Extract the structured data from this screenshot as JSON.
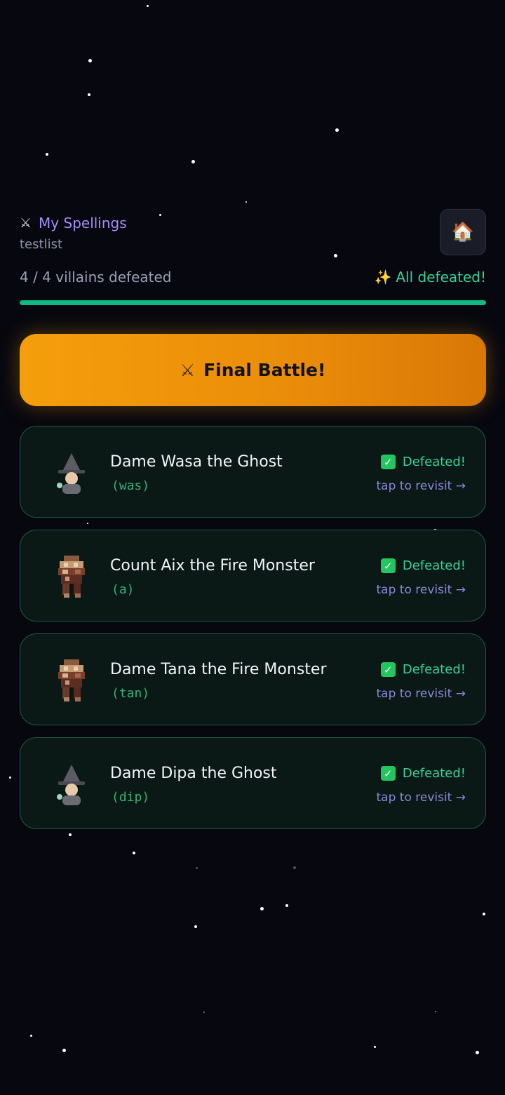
{
  "header": {
    "back_icon": "crossed-swords-icon",
    "back_label": "My Spellings",
    "list_name": "testlist",
    "home_icon": "house-icon",
    "home_glyph": "🏠"
  },
  "progress": {
    "text": "4 / 4 villains defeated",
    "status_icon": "sparkles-icon",
    "status_glyph": "✨",
    "status": "All defeated!",
    "defeated": 4,
    "total": 4,
    "fraction": 1.0
  },
  "final_battle": {
    "icon": "crossed-swords-icon",
    "glyph": "⚔",
    "label": "Final Battle!"
  },
  "villains": [
    {
      "name": "Dame Wasa the Ghost",
      "word": "(was)",
      "status": "Defeated!",
      "revisit": "tap to revisit →",
      "avatar": "witch-icon"
    },
    {
      "name": "Count Aix the Fire Monster",
      "word": "(a)",
      "status": "Defeated!",
      "revisit": "tap to revisit →",
      "avatar": "fire-monster-icon"
    },
    {
      "name": "Dame Tana the Fire Monster",
      "word": "(tan)",
      "status": "Defeated!",
      "revisit": "tap to revisit →",
      "avatar": "fire-monster-icon"
    },
    {
      "name": "Dame Dipa the Ghost",
      "word": "(dip)",
      "status": "Defeated!",
      "revisit": "tap to revisit →",
      "avatar": "witch-icon"
    }
  ],
  "colors": {
    "background": "#06070f",
    "accent_purple": "#a78bfa",
    "accent_green": "#34d399",
    "final_button": "#f59e0b"
  }
}
